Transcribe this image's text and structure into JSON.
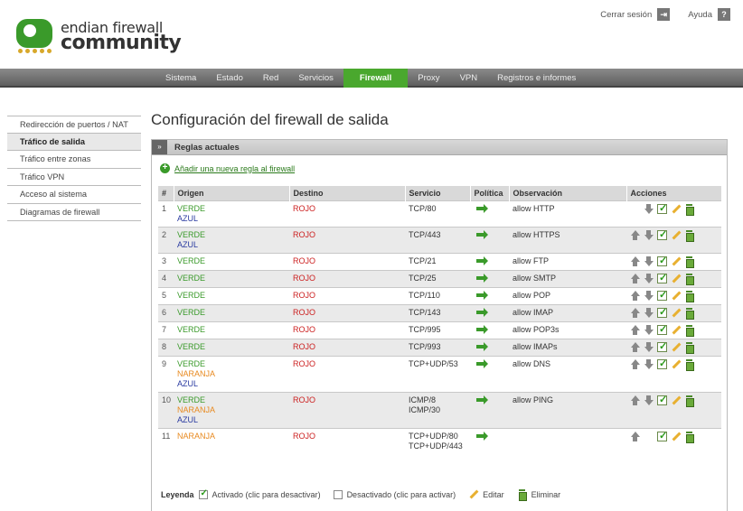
{
  "header": {
    "logo_line1": "endian firewall",
    "logo_line2": "community",
    "logout_label": "Cerrar sesión",
    "help_label": "Ayuda"
  },
  "nav": {
    "items": [
      "Sistema",
      "Estado",
      "Red",
      "Servicios",
      "Firewall",
      "Proxy",
      "VPN",
      "Registros e informes"
    ],
    "active": "Firewall"
  },
  "sidebar": {
    "items": [
      "Redirección de puertos / NAT",
      "Tráfico de salida",
      "Tráfico entre zonas",
      "Tráfico VPN",
      "Acceso al sistema",
      "Diagramas de firewall"
    ],
    "active": "Tráfico de salida"
  },
  "main": {
    "title": "Configuración del firewall de salida",
    "panel_toggle": "»",
    "panel_title": "Reglas actuales",
    "add_rule": "Añadir una nueva regla al firewall"
  },
  "table": {
    "columns": [
      "#",
      "Origen",
      "Destino",
      "Servicio",
      "Política",
      "Observación",
      "Acciones"
    ],
    "rows": [
      {
        "num": "1",
        "origin": [
          "VERDE",
          "AZUL"
        ],
        "dest": "ROJO",
        "service": [
          "TCP/80"
        ],
        "note": "allow HTTP",
        "first": true,
        "last": false
      },
      {
        "num": "2",
        "origin": [
          "VERDE",
          "AZUL"
        ],
        "dest": "ROJO",
        "service": [
          "TCP/443"
        ],
        "note": "allow HTTPS",
        "first": false,
        "last": false
      },
      {
        "num": "3",
        "origin": [
          "VERDE"
        ],
        "dest": "ROJO",
        "service": [
          "TCP/21"
        ],
        "note": "allow FTP",
        "first": false,
        "last": false
      },
      {
        "num": "4",
        "origin": [
          "VERDE"
        ],
        "dest": "ROJO",
        "service": [
          "TCP/25"
        ],
        "note": "allow SMTP",
        "first": false,
        "last": false
      },
      {
        "num": "5",
        "origin": [
          "VERDE"
        ],
        "dest": "ROJO",
        "service": [
          "TCP/110"
        ],
        "note": "allow POP",
        "first": false,
        "last": false
      },
      {
        "num": "6",
        "origin": [
          "VERDE"
        ],
        "dest": "ROJO",
        "service": [
          "TCP/143"
        ],
        "note": "allow IMAP",
        "first": false,
        "last": false
      },
      {
        "num": "7",
        "origin": [
          "VERDE"
        ],
        "dest": "ROJO",
        "service": [
          "TCP/995"
        ],
        "note": "allow POP3s",
        "first": false,
        "last": false
      },
      {
        "num": "8",
        "origin": [
          "VERDE"
        ],
        "dest": "ROJO",
        "service": [
          "TCP/993"
        ],
        "note": "allow IMAPs",
        "first": false,
        "last": false
      },
      {
        "num": "9",
        "origin": [
          "VERDE",
          "NARANJA",
          "AZUL"
        ],
        "dest": "ROJO",
        "service": [
          "TCP+UDP/53"
        ],
        "note": "allow DNS",
        "first": false,
        "last": false
      },
      {
        "num": "10",
        "origin": [
          "VERDE",
          "NARANJA",
          "AZUL"
        ],
        "dest": "ROJO",
        "service": [
          "ICMP/8",
          "ICMP/30"
        ],
        "note": "allow PING",
        "first": false,
        "last": false
      },
      {
        "num": "11",
        "origin": [
          "NARANJA"
        ],
        "dest": "ROJO",
        "service": [
          "TCP+UDP/80",
          "TCP+UDP/443"
        ],
        "note": "",
        "first": false,
        "last": true
      }
    ]
  },
  "legend": {
    "label": "Leyenda",
    "enabled": "Activado (clic para desactivar)",
    "disabled": "Desactivado (clic para activar)",
    "edit": "Editar",
    "delete": "Eliminar"
  },
  "colors": {
    "VERDE": "#3a9a2a",
    "ROJO": "#cc2020",
    "AZUL": "#2a3aa0",
    "NARANJA": "#e88a20",
    "nav_active": "#4aa82e"
  }
}
